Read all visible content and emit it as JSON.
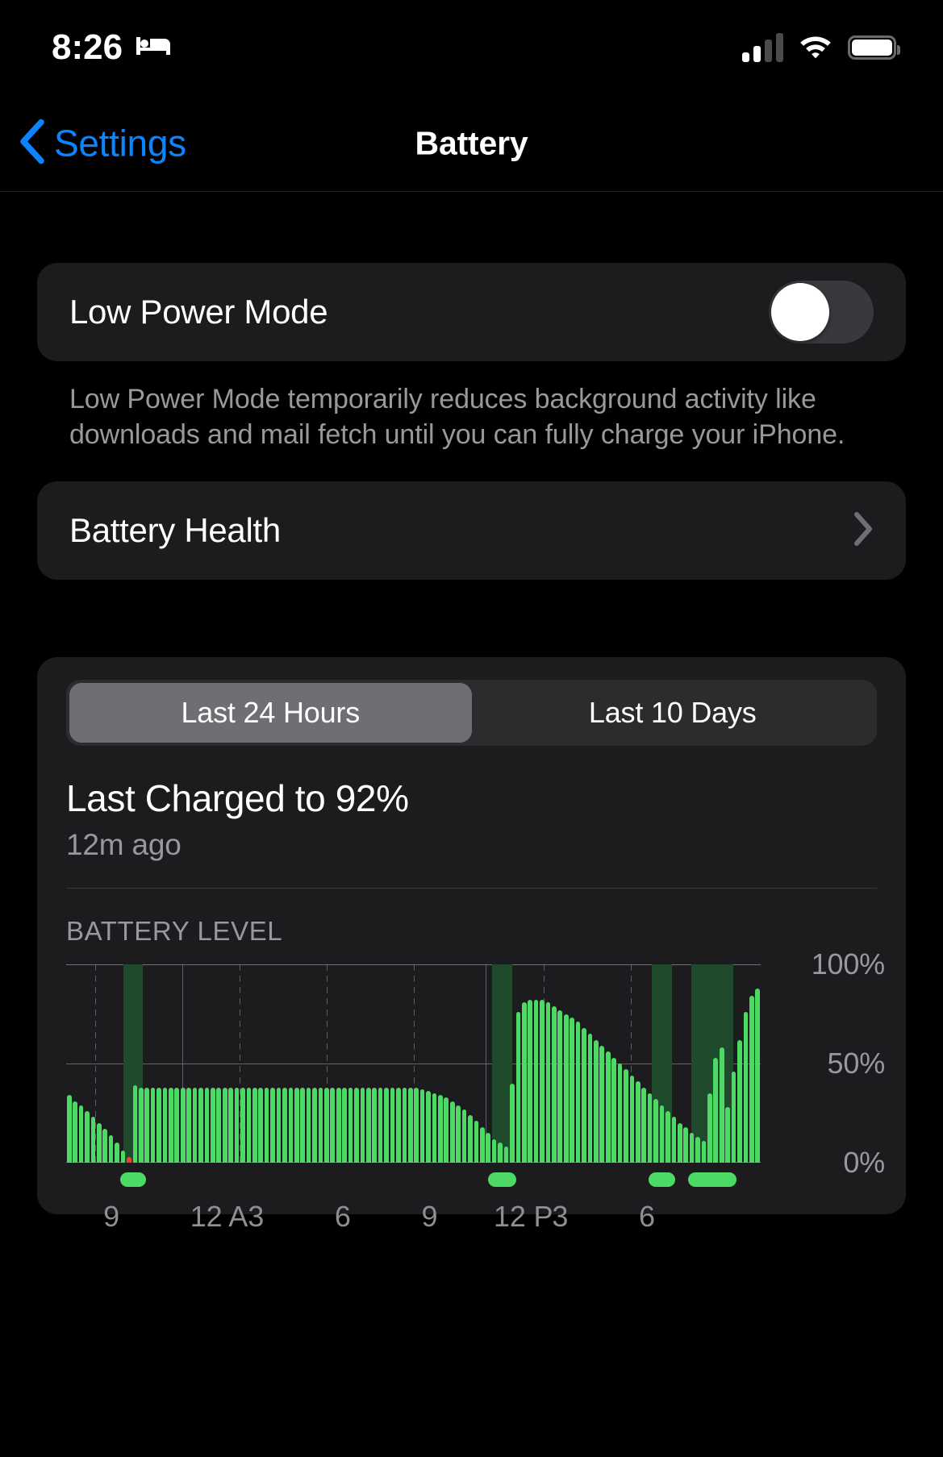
{
  "status_bar": {
    "time": "8:26",
    "focus_icon": "bed-icon",
    "cellular_icon": "cellular-signal-icon",
    "cellular_bars_filled": 2,
    "cellular_bars_total": 4,
    "wifi_icon": "wifi-icon",
    "battery_icon": "battery-icon",
    "battery_fill_percent": 92
  },
  "nav": {
    "back_label": "Settings",
    "back_icon": "chevron-left-icon",
    "title": "Battery"
  },
  "low_power_mode": {
    "label": "Low Power Mode",
    "enabled": false,
    "footnote": "Low Power Mode temporarily reduces background activity like downloads and mail fetch until you can fully charge your iPhone."
  },
  "battery_health": {
    "label": "Battery Health",
    "disclosure_icon": "chevron-right-icon"
  },
  "usage": {
    "segments": [
      {
        "label": "Last 24 Hours",
        "selected": true
      },
      {
        "label": "Last 10 Days",
        "selected": false
      }
    ],
    "last_charged_title": "Last Charged to 92%",
    "last_charged_sub": "12m ago",
    "section_caption": "BATTERY LEVEL"
  },
  "colors": {
    "accent_blue": "#0a84ff",
    "battery_green": "#4cd964",
    "charging_band_green": "#1f4a2c",
    "low_battery_red": "#ff3b30",
    "card_bg": "#1c1c1e",
    "segment_selected": "#6e6e73",
    "secondary_text": "#98989d"
  },
  "chart_data": {
    "type": "bar",
    "title": "BATTERY LEVEL",
    "xlabel": "",
    "ylabel": "",
    "ylim": [
      0,
      100
    ],
    "grid": true,
    "legend": null,
    "ytick_labels": [
      "100%",
      "50%",
      "0%"
    ],
    "ytick_values": [
      100,
      50,
      0
    ],
    "xtick_labels": [
      "9",
      "12 A",
      "3",
      "6",
      "9",
      "12 P",
      "3",
      "6"
    ],
    "xtick_positions": [
      0.042,
      0.167,
      0.25,
      0.375,
      0.5,
      0.604,
      0.688,
      0.813
    ],
    "xtick_line_styles": [
      "dashed",
      "solid",
      "dashed",
      "dashed",
      "dashed",
      "solid",
      "dashed",
      "dashed"
    ],
    "values": [
      34,
      31,
      29,
      26,
      23,
      20,
      17,
      14,
      10,
      6,
      3,
      39,
      38,
      38,
      38,
      38,
      38,
      38,
      38,
      38,
      38,
      38,
      38,
      38,
      38,
      38,
      38,
      38,
      38,
      38,
      38,
      38,
      38,
      38,
      38,
      38,
      38,
      38,
      38,
      38,
      38,
      38,
      38,
      38,
      38,
      38,
      38,
      38,
      38,
      38,
      38,
      38,
      38,
      38,
      38,
      38,
      38,
      38,
      38,
      37,
      36,
      35,
      34,
      33,
      31,
      29,
      27,
      24,
      21,
      18,
      15,
      12,
      10,
      8,
      40,
      76,
      81,
      82,
      82,
      82,
      81,
      79,
      77,
      75,
      73,
      71,
      68,
      65,
      62,
      59,
      56,
      53,
      50,
      47,
      44,
      41,
      38,
      35,
      32,
      29,
      26,
      23,
      20,
      18,
      15,
      13,
      11,
      35,
      53,
      58,
      28,
      46,
      62,
      76,
      84,
      88
    ],
    "charging_bands": [
      {
        "start_fraction": 0.083,
        "end_fraction": 0.11
      },
      {
        "start_fraction": 0.613,
        "end_fraction": 0.642
      },
      {
        "start_fraction": 0.843,
        "end_fraction": 0.872
      },
      {
        "start_fraction": 0.9,
        "end_fraction": 0.96
      }
    ],
    "charging_strip_segments": [
      {
        "start_fraction": 0.078,
        "end_fraction": 0.115
      },
      {
        "start_fraction": 0.608,
        "end_fraction": 0.648
      },
      {
        "start_fraction": 0.838,
        "end_fraction": 0.877
      },
      {
        "start_fraction": 0.895,
        "end_fraction": 0.965
      }
    ],
    "low_battery_bar_indices": [
      10
    ]
  }
}
